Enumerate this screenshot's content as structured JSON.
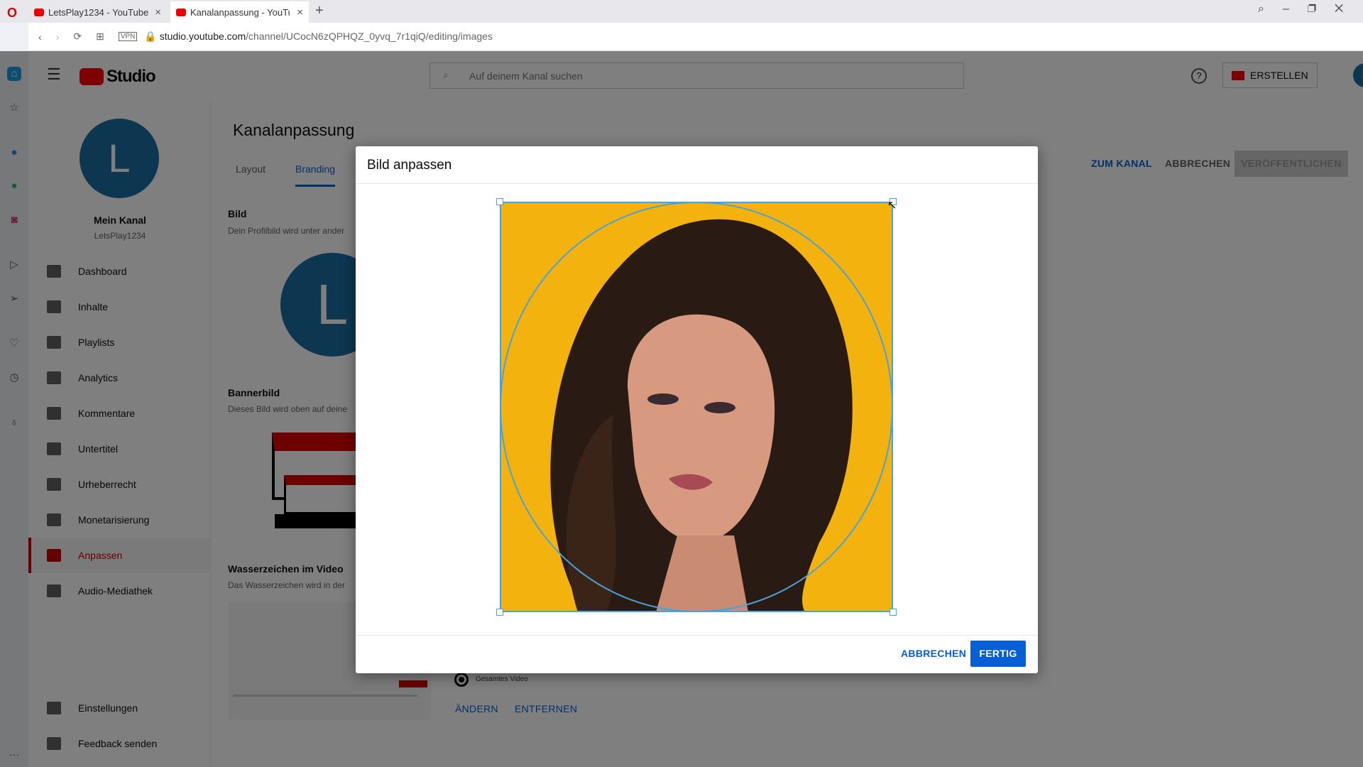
{
  "browser": {
    "tabs": [
      {
        "label": "LetsPlay1234 - YouTube"
      },
      {
        "label": "Kanalanpassung - YouTube"
      }
    ],
    "url_host": "studio.youtube.com",
    "url_path": "/channel/UCocN6zQPHQZ_0yvq_7r1qiQ/editing/images",
    "vpn": "VPN"
  },
  "header": {
    "logo": "Studio",
    "search_placeholder": "Auf deinem Kanal suchen",
    "create_label": "ERSTELLEN",
    "avatar": "L"
  },
  "channel": {
    "avatar": "L",
    "name": "Mein Kanal",
    "handle": "LetsPlay1234"
  },
  "nav": {
    "items": [
      {
        "label": "Dashboard"
      },
      {
        "label": "Inhalte"
      },
      {
        "label": "Playlists"
      },
      {
        "label": "Analytics"
      },
      {
        "label": "Kommentare"
      },
      {
        "label": "Untertitel"
      },
      {
        "label": "Urheberrecht"
      },
      {
        "label": "Monetarisierung"
      },
      {
        "label": "Anpassen",
        "active": true
      },
      {
        "label": "Audio-Mediathek"
      }
    ],
    "bottom": [
      {
        "label": "Einstellungen"
      },
      {
        "label": "Feedback senden"
      }
    ]
  },
  "main": {
    "title": "Kanalanpassung",
    "tabs": [
      {
        "label": "Layout"
      },
      {
        "label": "Branding",
        "active": true
      }
    ],
    "actions": {
      "view_channel": "ZUM KANAL",
      "cancel": "ABBRECHEN",
      "publish": "VERÖFFENTLICHEN"
    },
    "sections": {
      "picture_title": "Bild",
      "picture_desc": "Dein Profilbild wird unter ander",
      "picture_avatar": "L",
      "banner_title": "Bannerbild",
      "banner_desc": "Dieses Bild wird oben auf deine",
      "watermark_title": "Wasserzeichen im Video",
      "watermark_desc": "Das Wasserzeichen wird in der",
      "watermark_option": "Gesamtes Video",
      "change": "ÄNDERN",
      "remove": "ENTFERNEN"
    }
  },
  "dialog": {
    "title": "Bild anpassen",
    "cancel": "ABBRECHEN",
    "done": "FERTIG",
    "image_bg": "#f4b20f"
  },
  "colors": {
    "accent": "#065fd4",
    "brand_red": "#ff0000",
    "avatar_blue": "#1a6ea3"
  }
}
